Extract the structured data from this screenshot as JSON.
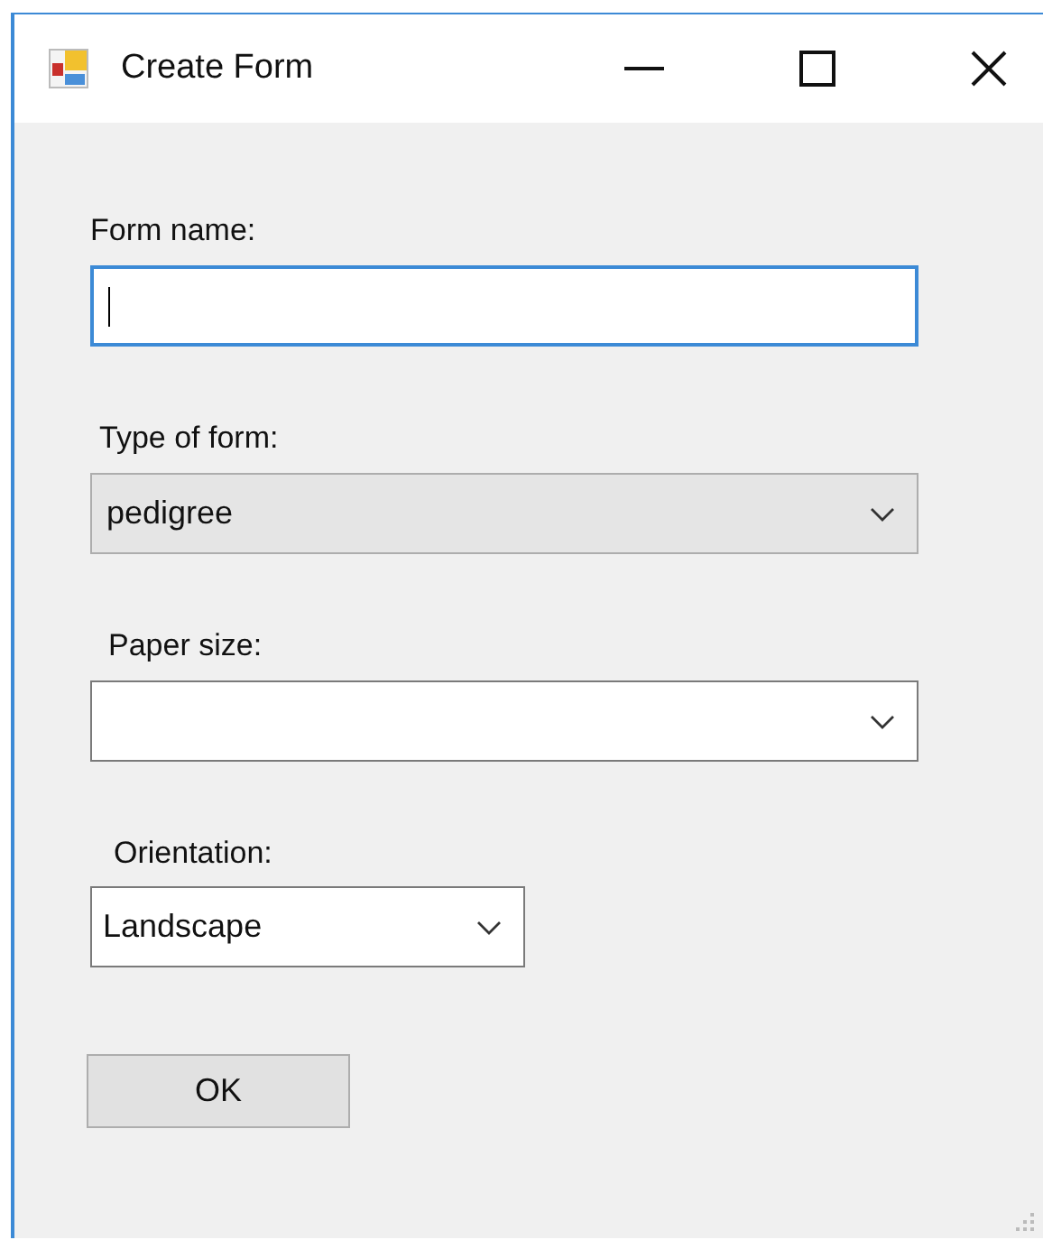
{
  "window": {
    "title": "Create Form"
  },
  "fields": [
    {
      "label": "Form name:",
      "kind": "text",
      "focused": true
    },
    {
      "label": "Type of form:",
      "kind": "list",
      "value": "pedigree",
      "focused": false
    },
    {
      "label": "Paper size:",
      "kind": "combo",
      "focused": false
    },
    {
      "label": "Orientation:",
      "kind": "combo",
      "value": "Landscape",
      "focused": false
    }
  ],
  "buttons": [
    "OK"
  ]
}
